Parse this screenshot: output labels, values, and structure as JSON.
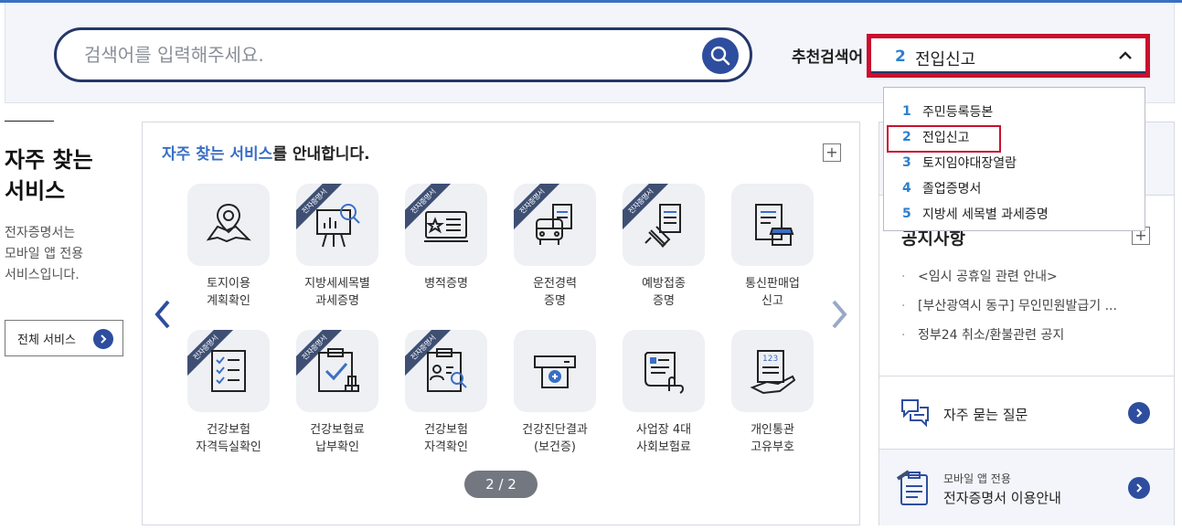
{
  "search": {
    "placeholder": "검색어를 입력해주세요.",
    "icon": "search-icon"
  },
  "recommended": {
    "label": "추천검색어",
    "selected_num": "2",
    "selected_text": "전입신고",
    "options": [
      {
        "num": "1",
        "text": "주민등록등본"
      },
      {
        "num": "2",
        "text": "전입신고"
      },
      {
        "num": "3",
        "text": "토지임야대장열람"
      },
      {
        "num": "4",
        "text": "졸업증명서"
      },
      {
        "num": "5",
        "text": "지방세 세목별 과세증명"
      }
    ]
  },
  "left": {
    "title_line1": "자주 찾는",
    "title_line2": "서비스",
    "desc_line1": "전자증명서는",
    "desc_line2": "모바일 앱 전용",
    "desc_line3": "서비스입니다.",
    "all_button": "전체 서비스"
  },
  "services": {
    "heading_highlight": "자주 찾는 서비스",
    "heading_rest": "를 안내합니다.",
    "plus": "+",
    "ribbon_text": "전자증명서",
    "pager": "2 / 2",
    "items": [
      {
        "line1": "토지이용",
        "line2": "계획확인",
        "ribbon": false,
        "icon": "map-pin-icon"
      },
      {
        "line1": "지방세세목별",
        "line2": "과세증명",
        "ribbon": true,
        "icon": "presentation-chart-icon"
      },
      {
        "line1": "병적증명",
        "line2": "",
        "ribbon": true,
        "icon": "military-id-card-icon"
      },
      {
        "line1": "운전경력",
        "line2": "증명",
        "ribbon": true,
        "icon": "bus-document-icon"
      },
      {
        "line1": "예방접종",
        "line2": "증명",
        "ribbon": true,
        "icon": "syringe-document-icon"
      },
      {
        "line1": "통신판매업",
        "line2": "신고",
        "ribbon": false,
        "icon": "store-document-icon"
      },
      {
        "line1": "건강보험",
        "line2": "자격득실확인",
        "ribbon": true,
        "icon": "checklist-icon"
      },
      {
        "line1": "건강보험료",
        "line2": "납부확인",
        "ribbon": true,
        "icon": "clipboard-check-stamp-icon"
      },
      {
        "line1": "건강보험",
        "line2": "자격확인",
        "ribbon": true,
        "icon": "person-search-document-icon"
      },
      {
        "line1": "건강진단결과",
        "line2": "(보건증)",
        "ribbon": false,
        "icon": "medical-printer-icon"
      },
      {
        "line1": "사업장 4대",
        "line2": "사회보험료",
        "ribbon": false,
        "icon": "scroll-hand-icon"
      },
      {
        "line1": "개인통관",
        "line2": "고유부호",
        "ribbon": false,
        "icon": "hand-document-123-icon"
      }
    ]
  },
  "notice": {
    "title": "공지사항",
    "plus": "+",
    "items": [
      "<임시 공휴일 관련 안내>",
      "[부산광역시 동구] 무인민원발급기 ...",
      "정부24 취소/환불관련 공지"
    ],
    "bullet": "·"
  },
  "faq": {
    "label": "자주 묻는 질문"
  },
  "mobile": {
    "small": "모바일 앱 전용",
    "big": "전자증명서 이용안내"
  },
  "colors": {
    "accent": "#2e4d9e",
    "highlight": "#3a6fc4",
    "alert_border": "#c8102e",
    "ribbon": "#3e4f73"
  }
}
